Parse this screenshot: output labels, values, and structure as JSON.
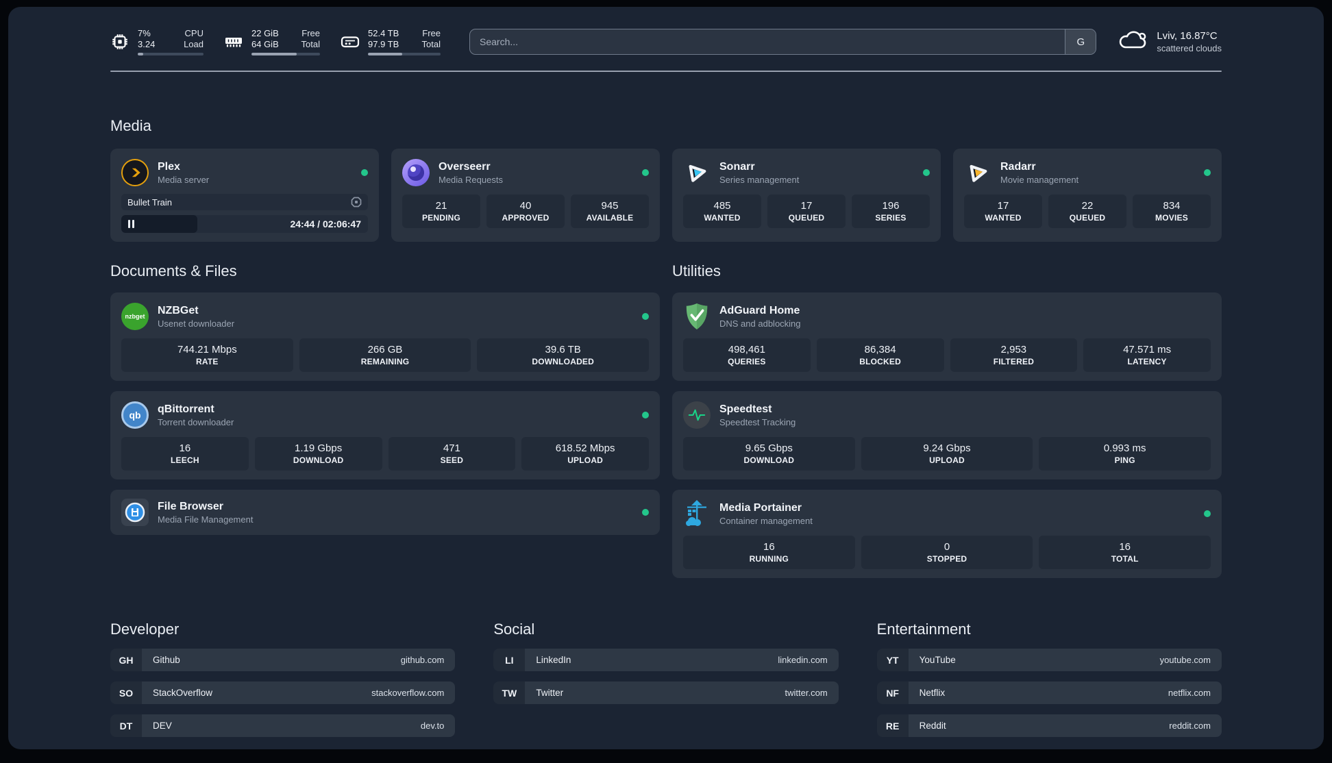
{
  "header": {
    "metrics": [
      {
        "values": [
          "7%",
          "3.24"
        ],
        "labels": [
          "CPU",
          "Load"
        ],
        "progress_pct": 8
      },
      {
        "values": [
          "22 GiB",
          "64 GiB"
        ],
        "labels": [
          "Free",
          "Total"
        ],
        "progress_pct": 66
      },
      {
        "values": [
          "52.4 TB",
          "97.9 TB"
        ],
        "labels": [
          "Free",
          "Total"
        ],
        "progress_pct": 47
      }
    ],
    "search": {
      "placeholder": "Search...",
      "engine": "G"
    },
    "weather": {
      "location_temp": "Lviv, 16.87°C",
      "condition": "scattered clouds"
    }
  },
  "media": {
    "title": "Media",
    "plex": {
      "name": "Plex",
      "subtitle": "Media server",
      "now_playing": {
        "title": "Bullet Train",
        "time": "24:44 / 02:06:47",
        "progress_pct": 28
      }
    },
    "overseerr": {
      "name": "Overseerr",
      "subtitle": "Media Requests",
      "stats": [
        {
          "value": "21",
          "label": "PENDING"
        },
        {
          "value": "40",
          "label": "APPROVED"
        },
        {
          "value": "945",
          "label": "AVAILABLE"
        }
      ]
    },
    "sonarr": {
      "name": "Sonarr",
      "subtitle": "Series management",
      "stats": [
        {
          "value": "485",
          "label": "WANTED"
        },
        {
          "value": "17",
          "label": "QUEUED"
        },
        {
          "value": "196",
          "label": "SERIES"
        }
      ]
    },
    "radarr": {
      "name": "Radarr",
      "subtitle": "Movie management",
      "stats": [
        {
          "value": "17",
          "label": "WANTED"
        },
        {
          "value": "22",
          "label": "QUEUED"
        },
        {
          "value": "834",
          "label": "MOVIES"
        }
      ]
    }
  },
  "documents": {
    "title": "Documents & Files",
    "nzbget": {
      "name": "NZBGet",
      "subtitle": "Usenet downloader",
      "icon_text": "nzbget",
      "stats": [
        {
          "value": "744.21 Mbps",
          "label": "RATE"
        },
        {
          "value": "266 GB",
          "label": "REMAINING"
        },
        {
          "value": "39.6 TB",
          "label": "DOWNLOADED"
        }
      ]
    },
    "qbittorrent": {
      "name": "qBittorrent",
      "subtitle": "Torrent downloader",
      "icon_text": "qb",
      "stats": [
        {
          "value": "16",
          "label": "LEECH"
        },
        {
          "value": "1.19 Gbps",
          "label": "DOWNLOAD"
        },
        {
          "value": "471",
          "label": "SEED"
        },
        {
          "value": "618.52 Mbps",
          "label": "UPLOAD"
        }
      ]
    },
    "filebrowser": {
      "name": "File Browser",
      "subtitle": "Media File Management"
    }
  },
  "utilities": {
    "title": "Utilities",
    "adguard": {
      "name": "AdGuard Home",
      "subtitle": "DNS and adblocking",
      "stats": [
        {
          "value": "498,461",
          "label": "QUERIES"
        },
        {
          "value": "86,384",
          "label": "BLOCKED"
        },
        {
          "value": "2,953",
          "label": "FILTERED"
        },
        {
          "value": "47.571 ms",
          "label": "LATENCY"
        }
      ]
    },
    "speedtest": {
      "name": "Speedtest",
      "subtitle": "Speedtest Tracking",
      "stats": [
        {
          "value": "9.65 Gbps",
          "label": "DOWNLOAD"
        },
        {
          "value": "9.24 Gbps",
          "label": "UPLOAD"
        },
        {
          "value": "0.993 ms",
          "label": "PING"
        }
      ]
    },
    "portainer": {
      "name": "Media Portainer",
      "subtitle": "Container management",
      "stats": [
        {
          "value": "16",
          "label": "RUNNING"
        },
        {
          "value": "0",
          "label": "STOPPED"
        },
        {
          "value": "16",
          "label": "TOTAL"
        }
      ]
    }
  },
  "bookmarks": [
    {
      "title": "Developer",
      "links": [
        {
          "tag": "GH",
          "name": "Github",
          "url": "github.com"
        },
        {
          "tag": "SO",
          "name": "StackOverflow",
          "url": "stackoverflow.com"
        },
        {
          "tag": "DT",
          "name": "DEV",
          "url": "dev.to"
        }
      ]
    },
    {
      "title": "Social",
      "links": [
        {
          "tag": "LI",
          "name": "LinkedIn",
          "url": "linkedin.com"
        },
        {
          "tag": "TW",
          "name": "Twitter",
          "url": "twitter.com"
        }
      ]
    },
    {
      "title": "Entertainment",
      "links": [
        {
          "tag": "YT",
          "name": "YouTube",
          "url": "youtube.com"
        },
        {
          "tag": "NF",
          "name": "Netflix",
          "url": "netflix.com"
        },
        {
          "tag": "RE",
          "name": "Reddit",
          "url": "reddit.com"
        }
      ]
    }
  ],
  "colors": {
    "status_online": "#23c68b"
  }
}
